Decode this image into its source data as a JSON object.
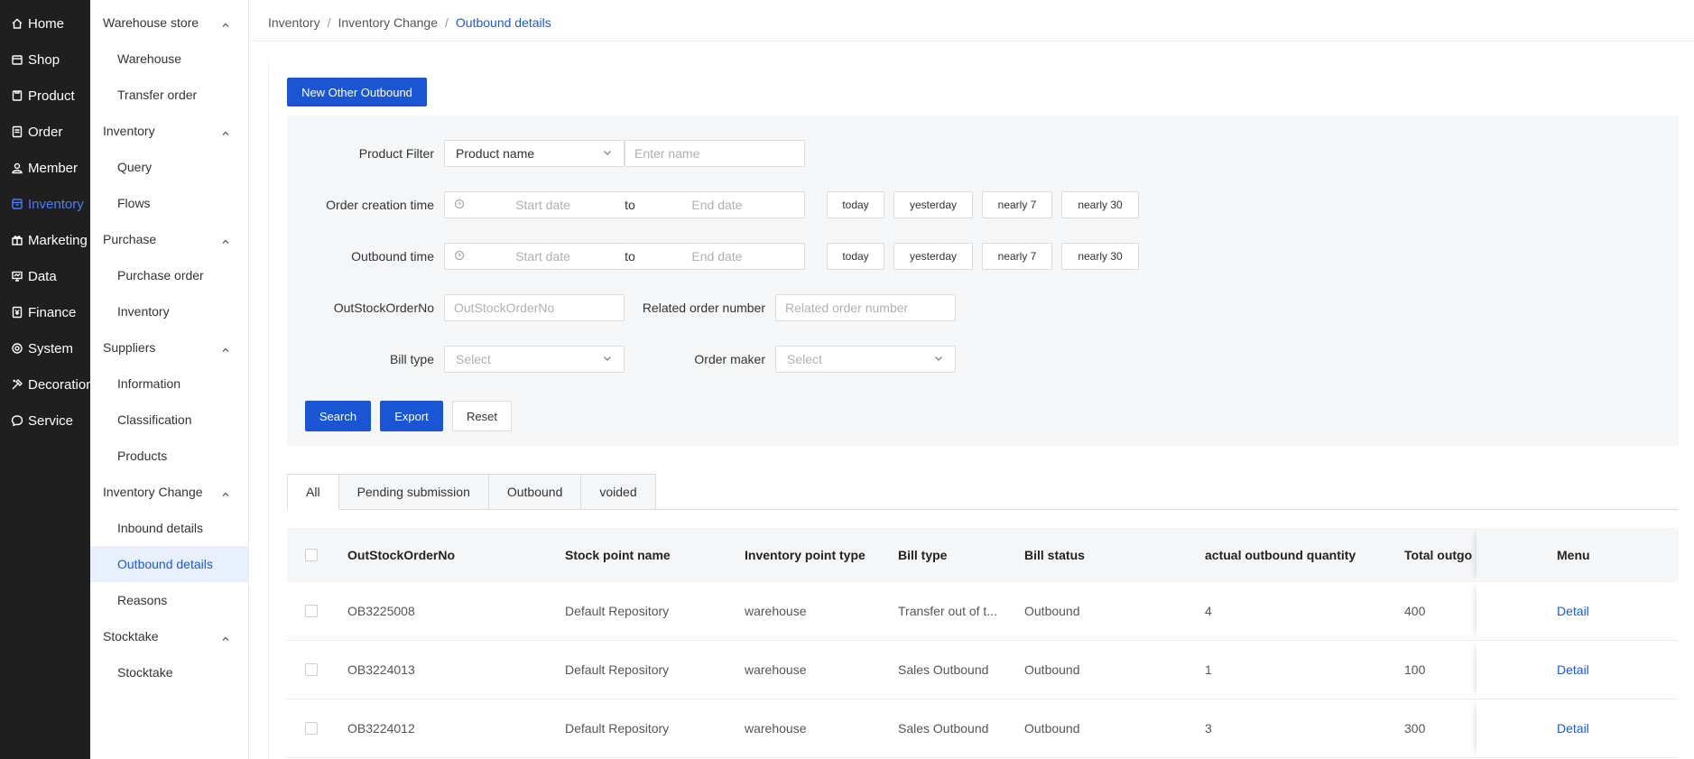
{
  "nav_primary": [
    {
      "label": "Home",
      "icon": "home-icon"
    },
    {
      "label": "Shop",
      "icon": "shop-icon"
    },
    {
      "label": "Product",
      "icon": "product-icon"
    },
    {
      "label": "Order",
      "icon": "order-icon"
    },
    {
      "label": "Member",
      "icon": "member-icon"
    },
    {
      "label": "Inventory",
      "icon": "inventory-icon",
      "active": true
    },
    {
      "label": "Marketing",
      "icon": "marketing-icon"
    },
    {
      "label": "Data",
      "icon": "data-icon"
    },
    {
      "label": "Finance",
      "icon": "finance-icon"
    },
    {
      "label": "System",
      "icon": "system-icon"
    },
    {
      "label": "Decoration",
      "icon": "decoration-icon"
    },
    {
      "label": "Service",
      "icon": "service-icon"
    }
  ],
  "nav_secondary": {
    "warehouse": {
      "title": "Warehouse store",
      "items": [
        "Warehouse",
        "Transfer order"
      ]
    },
    "inventory": {
      "title": "Inventory",
      "items": [
        "Query",
        "Flows"
      ]
    },
    "purchase": {
      "title": "Purchase",
      "items": [
        "Purchase order",
        "Inventory"
      ]
    },
    "suppliers": {
      "title": "Suppliers",
      "items": [
        "Information",
        "Classification",
        "Products"
      ]
    },
    "inventory_change": {
      "title": "Inventory Change",
      "items": [
        "Inbound details",
        "Outbound details",
        "Reasons"
      ]
    },
    "stocktake": {
      "title": "Stocktake",
      "items": [
        "Stocktake"
      ]
    }
  },
  "breadcrumb": {
    "level1": "Inventory",
    "level2": "Inventory Change",
    "current": "Outbound details",
    "sep": "/"
  },
  "new_button": "New Other Outbound",
  "filters": {
    "product_filter": {
      "label": "Product Filter",
      "select_value": "Product name",
      "input_placeholder": "Enter name"
    },
    "order_creation_time": {
      "label": "Order creation time",
      "start": "Start date",
      "to": "to",
      "end": "End date"
    },
    "outbound_time": {
      "label": "Outbound time",
      "start": "Start date",
      "to": "to",
      "end": "End date"
    },
    "quick_dates": [
      "today",
      "yesterday",
      "nearly 7",
      "nearly 30"
    ],
    "out_stock_order_no": {
      "label": "OutStockOrderNo",
      "placeholder": "OutStockOrderNo"
    },
    "related_order": {
      "label": "Related order number",
      "placeholder": "Related order number"
    },
    "bill_type": {
      "label": "Bill type",
      "placeholder": "Select"
    },
    "order_maker": {
      "label": "Order maker",
      "placeholder": "Select"
    }
  },
  "actions": {
    "search": "Search",
    "export": "Export",
    "reset": "Reset"
  },
  "tabs": [
    "All",
    "Pending submission",
    "Outbound",
    "voided"
  ],
  "table": {
    "columns": [
      "OutStockOrderNo",
      "Stock point name",
      "Inventory point type",
      "Bill type",
      "Bill status",
      "actual outbound quantity",
      "Total outgo",
      "Menu"
    ],
    "rows": [
      {
        "order_no": "OB3225008",
        "stock_point": "Default Repository",
        "point_type": "warehouse",
        "bill_type": "Transfer out of t...",
        "status": "Outbound",
        "qty": "4",
        "total": "400",
        "menu": "Detail"
      },
      {
        "order_no": "OB3224013",
        "stock_point": "Default Repository",
        "point_type": "warehouse",
        "bill_type": "Sales Outbound",
        "status": "Outbound",
        "qty": "1",
        "total": "100",
        "menu": "Detail"
      },
      {
        "order_no": "OB3224012",
        "stock_point": "Default Repository",
        "point_type": "warehouse",
        "bill_type": "Sales Outbound",
        "status": "Outbound",
        "qty": "3",
        "total": "300",
        "menu": "Detail"
      }
    ]
  },
  "colors": {
    "primary": "#1a55d3",
    "link": "#1a5ad6",
    "nav_bg": "#1f1f1f",
    "nav_active": "#4a7dff",
    "panel_bg": "#f5f6f8",
    "selected_bg": "#e8effd"
  }
}
